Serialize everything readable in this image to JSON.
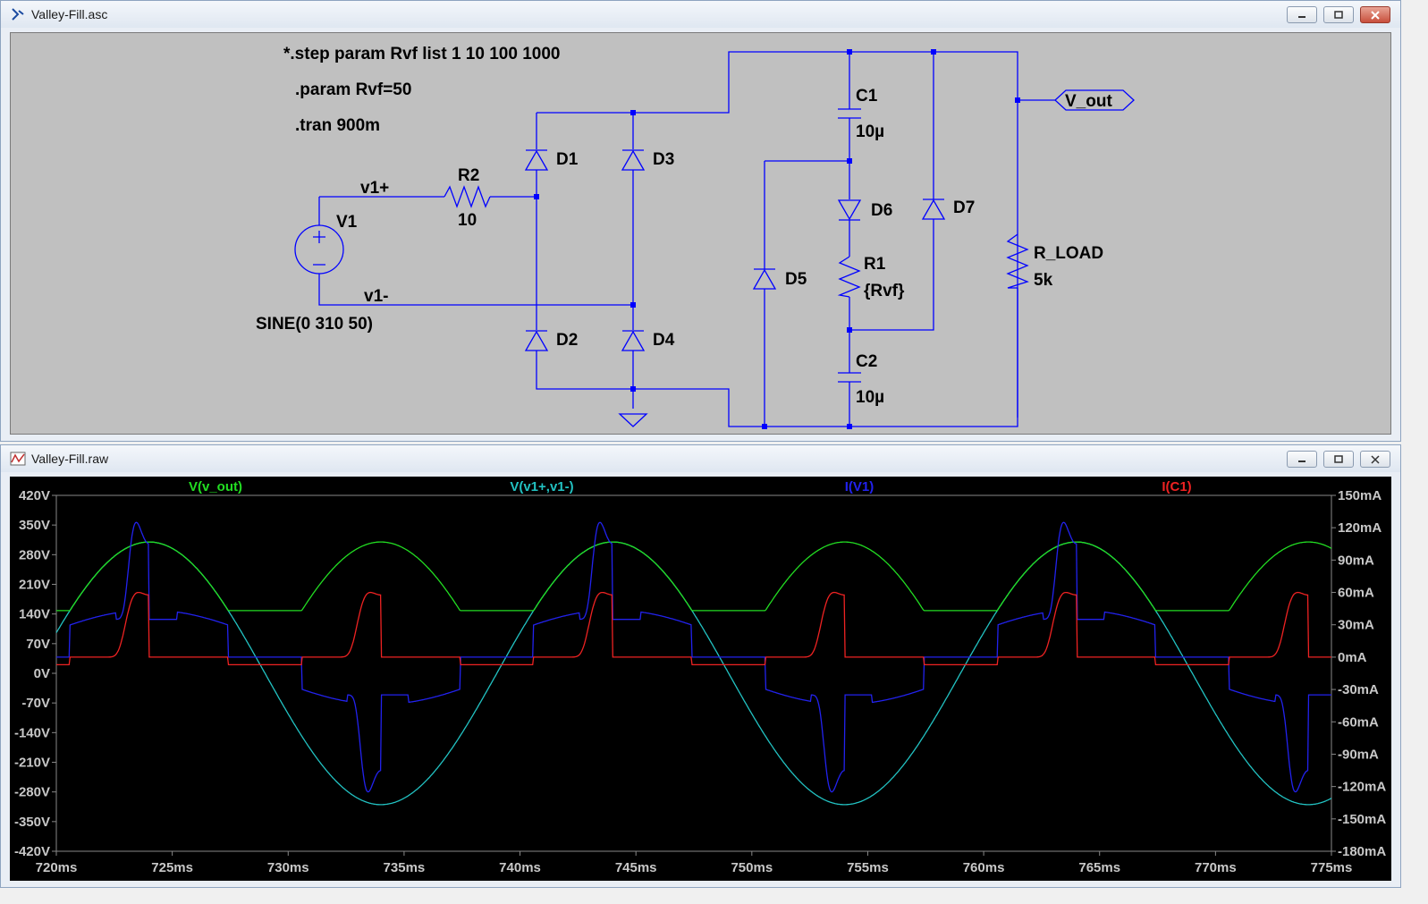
{
  "schematic": {
    "title": "Valley-Fill.asc",
    "directives": {
      "step": "*.step param Rvf list 1 10 100 1000",
      "param": ".param Rvf=50",
      "tran": ".tran 900m"
    },
    "components": {
      "V1": {
        "name": "V1",
        "value": "SINE(0 310 50)"
      },
      "R2": {
        "name": "R2",
        "value": "10"
      },
      "R1": {
        "name": "R1",
        "value": "{Rvf}"
      },
      "C1": {
        "name": "C1",
        "value": "10µ"
      },
      "C2": {
        "name": "C2",
        "value": "10µ"
      },
      "R_LOAD": {
        "name": "R_LOAD",
        "value": "5k"
      },
      "D1": "D1",
      "D2": "D2",
      "D3": "D3",
      "D4": "D4",
      "D5": "D5",
      "D6": "D6",
      "D7": "D7"
    },
    "nets": {
      "v1p": "v1+",
      "v1m": "v1-",
      "vout": "V_out"
    }
  },
  "waveform": {
    "title": "Valley-Fill.raw",
    "traces": [
      {
        "label": "V(v_out)",
        "color": "#22dd22"
      },
      {
        "label": "V(v1+,v1-)",
        "color": "#22c2c2"
      },
      {
        "label": "I(V1)",
        "color": "#2222ee"
      },
      {
        "label": "I(C1)",
        "color": "#ee2222"
      }
    ],
    "left_axis": [
      "420V",
      "350V",
      "280V",
      "210V",
      "140V",
      "70V",
      "0V",
      "-70V",
      "-140V",
      "-210V",
      "-280V",
      "-350V",
      "-420V"
    ],
    "right_axis": [
      "150mA",
      "120mA",
      "90mA",
      "60mA",
      "30mA",
      "0mA",
      "-30mA",
      "-60mA",
      "-90mA",
      "-120mA",
      "-150mA",
      "-180mA"
    ],
    "x_axis": [
      "720ms",
      "725ms",
      "730ms",
      "735ms",
      "740ms",
      "745ms",
      "750ms",
      "755ms",
      "760ms",
      "765ms",
      "770ms",
      "775ms"
    ]
  },
  "chart_data": {
    "type": "line",
    "x_range": [
      720,
      775
    ],
    "x_unit": "ms",
    "ylim_left": [
      -420,
      420
    ],
    "ylim_right": [
      -180,
      150
    ],
    "series": [
      {
        "name": "V(v_out)",
        "axis": "left",
        "description_points": {
          "x": [
            720,
            721.7,
            725,
            728.3,
            731.7,
            735,
            738.3,
            741.7,
            745,
            748.3,
            751.7,
            755,
            758.3,
            761.7,
            765,
            768.3,
            771.7,
            775
          ],
          "y": [
            150,
            148,
            310,
            150,
            148,
            310,
            150,
            148,
            310,
            150,
            148,
            310,
            150,
            148,
            310,
            150,
            148,
            308
          ]
        }
      },
      {
        "name": "V(v1+,v1-)",
        "axis": "left",
        "amplitude": 310,
        "frequency_hz": 50,
        "phase_zero_ms": 720
      },
      {
        "name": "I(V1)",
        "axis": "right",
        "peak_mA": 125,
        "plateau_mA": 35
      },
      {
        "name": "I(C1)",
        "axis": "right",
        "peak_mA": 60,
        "base_mA": 0,
        "charge_mA": -7
      }
    ]
  }
}
